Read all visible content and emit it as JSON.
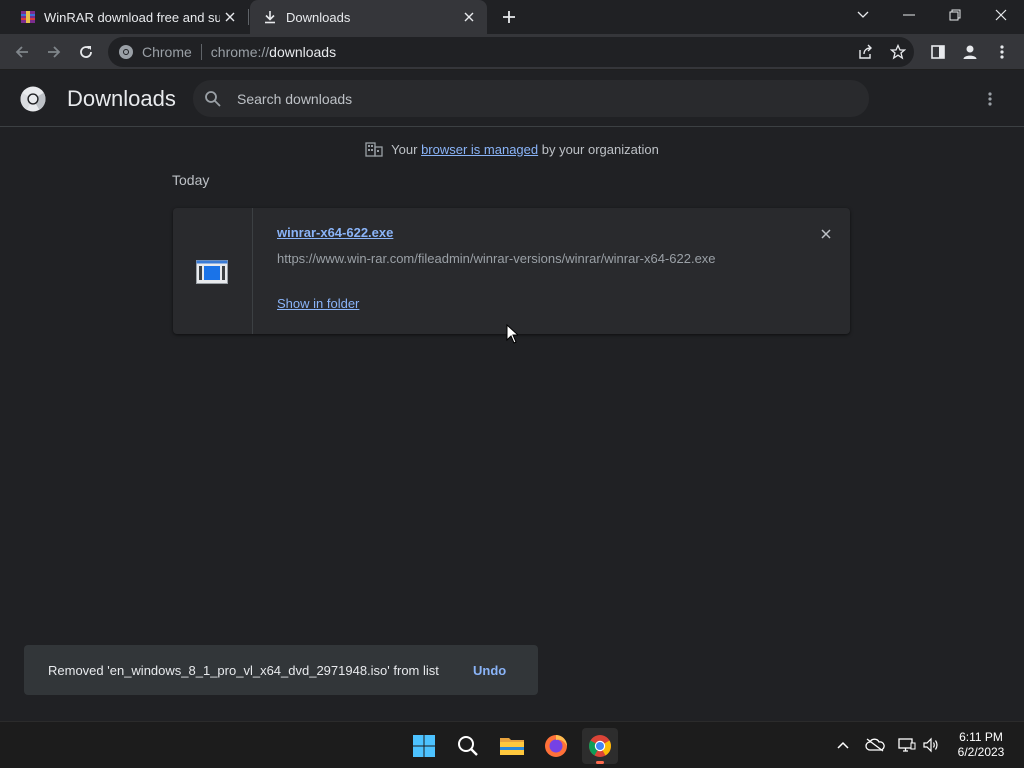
{
  "browser": {
    "tabs": [
      {
        "title": "WinRAR download free and supp",
        "favicon": "winrar-icon",
        "active": false
      },
      {
        "title": "Downloads",
        "favicon": "download-icon",
        "active": true
      }
    ],
    "omnibox": {
      "site_label": "Chrome",
      "url_scheme": "chrome://",
      "url_path": "downloads"
    }
  },
  "page": {
    "title": "Downloads",
    "search_placeholder": "Search downloads",
    "managed_banner": {
      "prefix": "Your ",
      "link": "browser is managed",
      "suffix": " by your organization"
    },
    "section_heading": "Today",
    "downloads": [
      {
        "filename": "winrar-x64-622.exe",
        "url": "https://www.win-rar.com/fileadmin/winrar-versions/winrar/winrar-x64-622.exe",
        "action": "Show in folder"
      }
    ]
  },
  "toast": {
    "message": "Removed 'en_windows_8_1_pro_vl_x64_dvd_2971948.iso' from list",
    "action": "Undo"
  },
  "taskbar": {
    "apps": [
      "start-icon",
      "search-icon",
      "file-explorer-icon",
      "firefox-icon",
      "chrome-icon"
    ],
    "time": "6:11 PM",
    "date": "6/2/2023"
  },
  "colors": {
    "link": "#8ab4f8",
    "page_bg": "#202124",
    "toolbar_bg": "#35363a",
    "card_bg": "#292a2d"
  }
}
